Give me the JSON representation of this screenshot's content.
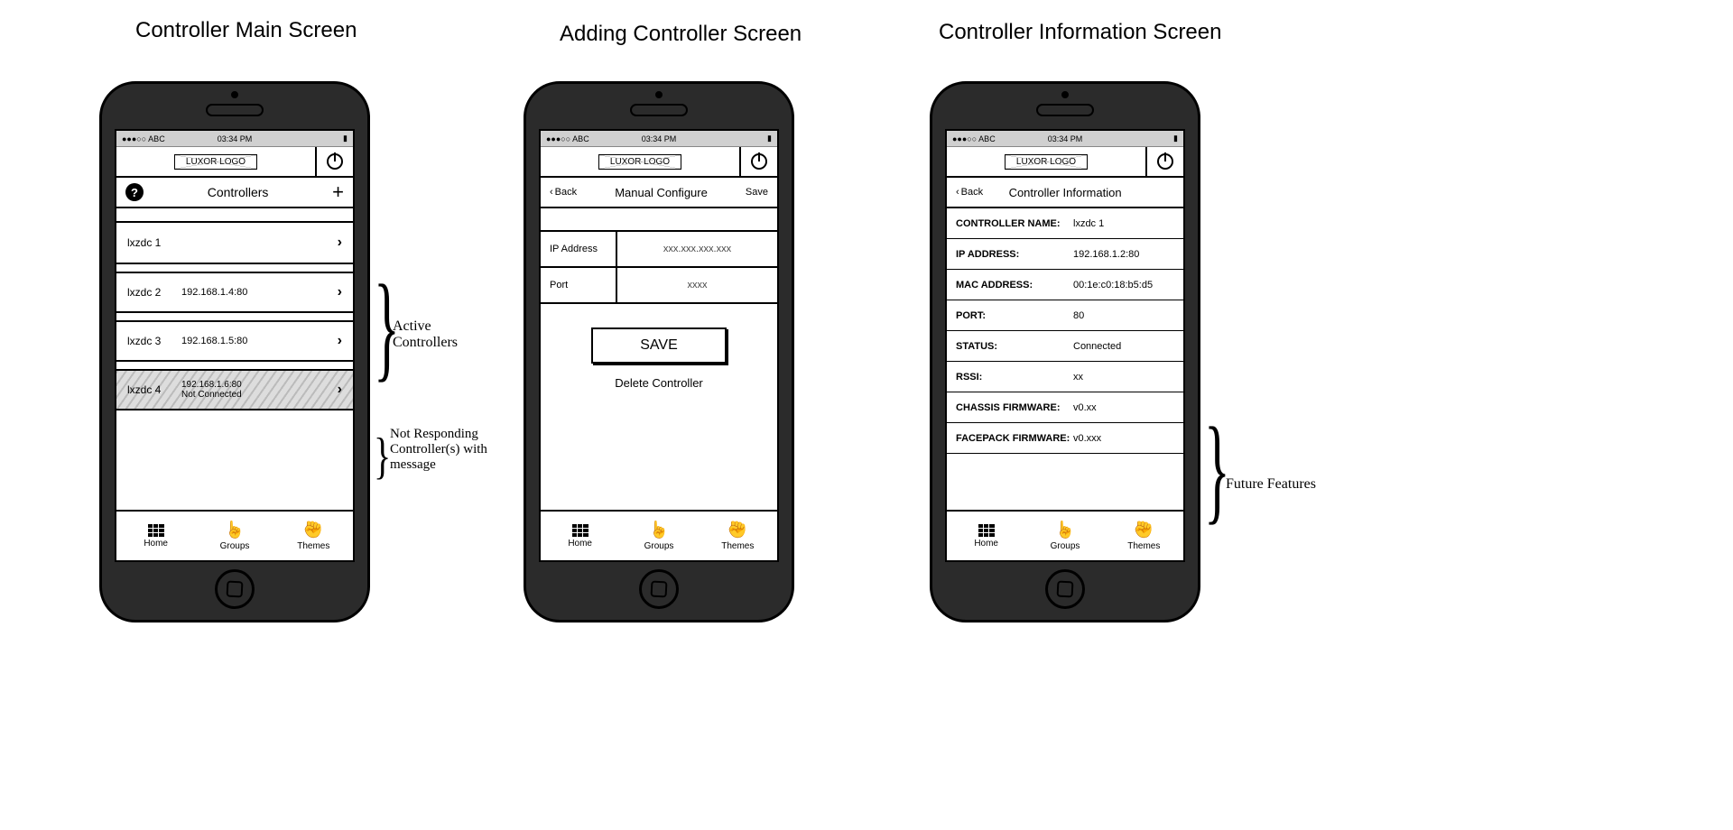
{
  "titles": {
    "screen1": "Controller Main Screen",
    "screen2": "Adding Controller Screen",
    "screen3": "Controller Information Screen"
  },
  "statusbar": {
    "carrier": "●●●○○ ABC",
    "time": "03:34 PM",
    "battery": "▮"
  },
  "logo_text": "LUXOR LOGO",
  "screen1": {
    "nav_title": "Controllers",
    "rows": [
      {
        "name": "lxzdc 1",
        "sub": ""
      },
      {
        "name": "lxzdc 2",
        "sub": "192.168.1.4:80"
      },
      {
        "name": "lxzdc 3",
        "sub": "192.168.1.5:80"
      },
      {
        "name": "lxzdc 4",
        "sub": "192.168.1.6:80",
        "note": "Not Connected",
        "dim": true
      }
    ]
  },
  "screen2": {
    "back": "Back",
    "nav_title": "Manual Configure",
    "nav_save": "Save",
    "fields": [
      {
        "label": "IP Address",
        "value": "xxx.xxx.xxx.xxx"
      },
      {
        "label": "Port",
        "value": "xxxx"
      }
    ],
    "save_button": "SAVE",
    "delete_link": "Delete Controller"
  },
  "screen3": {
    "back": "Back",
    "nav_title": "Controller Information",
    "info": [
      {
        "label": "CONTROLLER NAME:",
        "value": "lxzdc 1"
      },
      {
        "label": "IP ADDRESS:",
        "value": "192.168.1.2:80"
      },
      {
        "label": "MAC ADDRESS:",
        "value": "00:1e:c0:18:b5:d5"
      },
      {
        "label": "PORT:",
        "value": "80"
      },
      {
        "label": "STATUS:",
        "value": "Connected"
      },
      {
        "label": "RSSI:",
        "value": "xx"
      },
      {
        "label": "CHASSIS FIRMWARE:",
        "value": "v0.xx"
      },
      {
        "label": "FACEPACK FIRMWARE:",
        "value": "v0.xxx"
      }
    ]
  },
  "tabs": {
    "home": "Home",
    "groups": "Groups",
    "themes": "Themes"
  },
  "annotations": {
    "active": "Active\nControllers",
    "not_responding": "Not Responding\nController(s) with\nmessage",
    "future": "Future Features"
  }
}
